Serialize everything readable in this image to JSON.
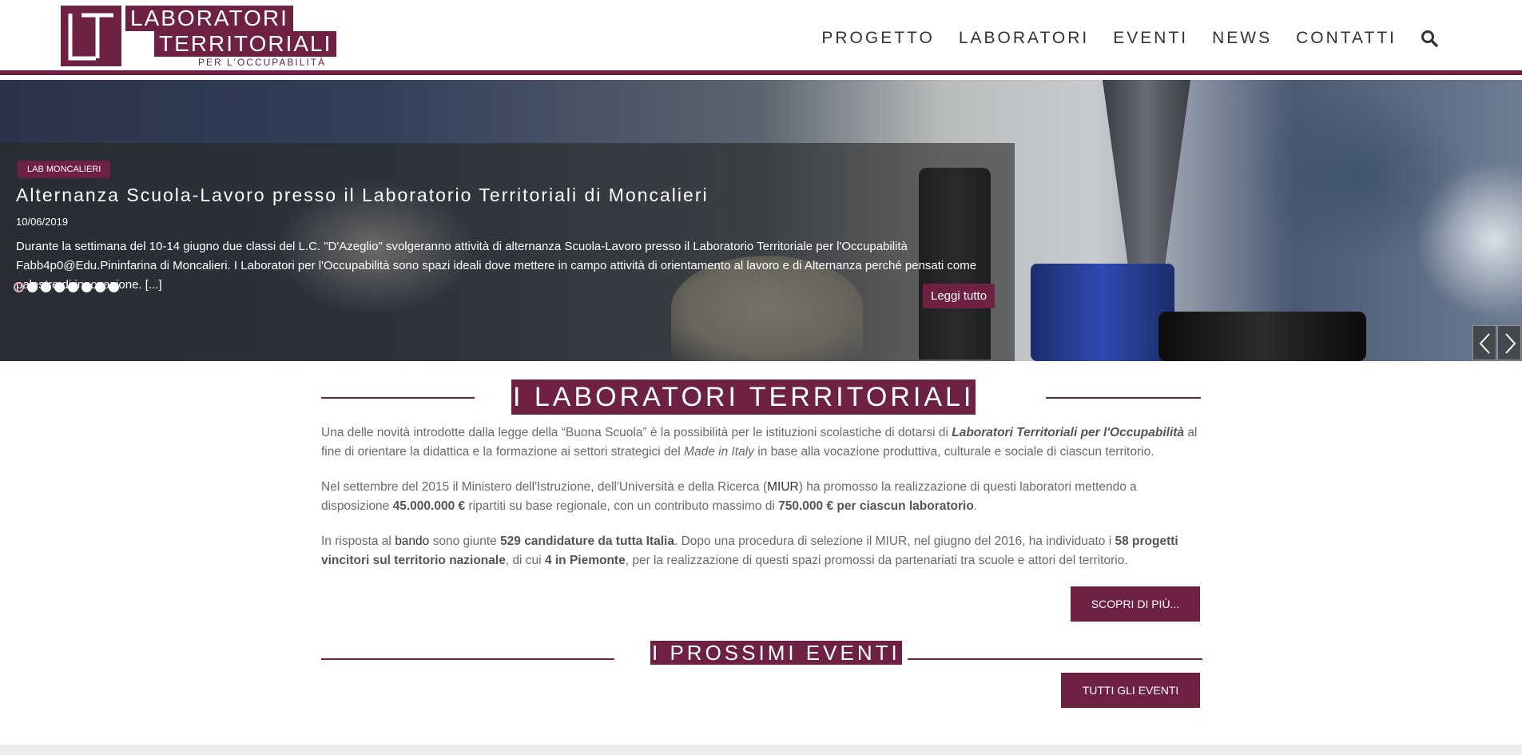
{
  "logo": {
    "line1": "LABORATORI",
    "line2": "TERRITORIALI",
    "subtitle": "PER L'OCCUPABILITÀ"
  },
  "nav": {
    "items": [
      "PROGETTO",
      "LABORATORI",
      "EVENTI",
      "NEWS",
      "CONTATTI"
    ],
    "search_icon": "search-icon"
  },
  "hero": {
    "category": "LAB MONCALIERI",
    "title": "Alternanza Scuola-Lavoro presso il Laboratorio Territoriali di Moncalieri",
    "date": "10/06/2019",
    "text": "Durante la settimana del 10-14 giugno due classi del L.C. \"D'Azeglio\" svolgeranno attività di alternanza Scuola-Lavoro presso il Laboratorio Territoriale per l'Occupabilità Fabb4p0@Edu.Pininfarina di Moncalieri. I Laboratori per l'Occupabilità sono spazi ideali dove mettere in campo attività di orientamento al lavoro e di Alternanza perché pensati come palestre di innovazione. [...]",
    "read_more": "Leggi tutto",
    "slide_count": 8,
    "active_slide": 1
  },
  "section_labs": {
    "title": "I LABORATORI TERRITORIALI",
    "p1": {
      "a": "Una delle novità introdotte dalla legge della “Buona Scuola” è la possibilità per le istituzioni scolastiche di dotarsi di ",
      "b": "Laboratori Territoriali per l'Occupabilità",
      "c": " al fine di orientare la didattica e la formazione ai settori strategici del ",
      "d": "Made in Italy",
      "e": " in base alla vocazione produttiva, culturale e sociale di ciascun territorio."
    },
    "p2": {
      "a": "Nel settembre del 2015 il Ministero dell'Istruzione, dell'Università e della Ricerca (",
      "b": "MIUR",
      "c": ") ha promosso la realizzazione di questi laboratori mettendo a disposizione ",
      "d": "45.000.000 €",
      "e": " ripartiti su base regionale, con un contributo massimo di ",
      "f": "750.000 € per ciascun laboratorio",
      "g": "."
    },
    "p3": {
      "a": "In risposta al ",
      "b": "bando",
      "c": " sono giunte ",
      "d": "529 candidature da tutta Italia",
      "e": ". Dopo una procedura di selezione il MIUR, nel giugno del 2016, ha individuato i ",
      "f": "58 progetti vincitori sul territorio nazionale",
      "g": ", di cui ",
      "h": "4 in Piemonte",
      "i": ", per la realizzazione di questi spazi promossi da partenariati tra scuole e attori del territorio."
    },
    "button": "SCOPRI DI PIÙ..."
  },
  "section_events": {
    "title": "I PROSSIMI EVENTI",
    "button": "TUTTI GLI EVENTI"
  },
  "colors": {
    "brand": "#6e2143"
  }
}
